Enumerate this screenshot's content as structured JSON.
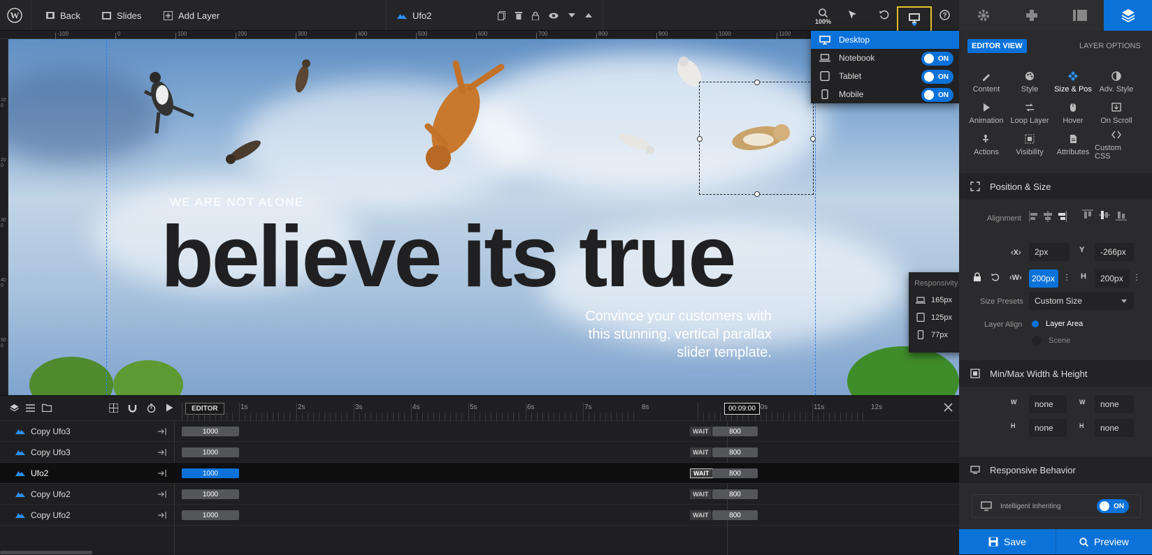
{
  "topbar": {
    "back_label": "Back",
    "slides_label": "Slides",
    "add_layer_label": "Add Layer",
    "layer_name": "Ufo2",
    "zoom": "100%"
  },
  "device_menu": {
    "items": [
      {
        "label": "Desktop",
        "toggle": ""
      },
      {
        "label": "Notebook",
        "toggle": "ON"
      },
      {
        "label": "Tablet",
        "toggle": "ON"
      },
      {
        "label": "Mobile",
        "toggle": "ON"
      }
    ]
  },
  "ruler": {
    "top_ticks": [
      "-100",
      "0",
      "100",
      "200",
      "300",
      "400",
      "500",
      "600",
      "700",
      "800",
      "900",
      "1000",
      "1100"
    ],
    "left_ticks": [
      "100",
      "200",
      "300",
      "400",
      "500"
    ]
  },
  "canvas": {
    "tagline": "WE ARE NOT ALONE",
    "headline": "believe its true",
    "body": "Convince your customers with this stunning, vertical parallax slider template."
  },
  "responsivity": {
    "title": "Responsivity",
    "items": [
      {
        "label": "165px"
      },
      {
        "label": "125px"
      },
      {
        "label": "77px"
      }
    ]
  },
  "right_panel": {
    "editor_view": "EDITOR VIEW",
    "layer_options": "LAYER OPTIONS",
    "tools": [
      {
        "label": "Content"
      },
      {
        "label": "Style"
      },
      {
        "label": "Size & Pos"
      },
      {
        "label": "Adv. Style"
      },
      {
        "label": "Animation"
      },
      {
        "label": "Loop Layer"
      },
      {
        "label": "Hover"
      },
      {
        "label": "On Scroll"
      },
      {
        "label": "Actions"
      },
      {
        "label": "Visibility"
      },
      {
        "label": "Attributes"
      },
      {
        "label": "Custom CSS"
      }
    ],
    "position_size": {
      "title": "Position & Size",
      "alignment_label": "Alignment",
      "x_label": "X",
      "x_value": "2px",
      "y_label": "Y",
      "y_value": "-266px",
      "w_label": "W",
      "w_value": "200px",
      "h_label": "H",
      "h_value": "200px",
      "size_presets_label": "Size Presets",
      "size_presets_value": "Custom Size",
      "layer_align_label": "Layer Align",
      "layer_area": "Layer Area",
      "scene": "Scene"
    },
    "minmax": {
      "title": "Min/Max Width & Height",
      "values": [
        "none",
        "none",
        "none",
        "none"
      ]
    },
    "responsive": {
      "title": "Responsive Behavior",
      "intelligent_inheriting": "Intelligent Inheriting",
      "toggle": "ON"
    },
    "save_label": "Save",
    "preview_label": "Preview"
  },
  "timeline": {
    "editor_label": "EDITOR",
    "current_time": "00:09:00",
    "seconds": [
      "1s",
      "2s",
      "3s",
      "4s",
      "5s",
      "6s",
      "7s",
      "8s",
      "10s",
      "11s",
      "12s"
    ],
    "rows": [
      {
        "name": "Copy Ufo3",
        "start": "1000",
        "wait": "WAIT",
        "end": "800"
      },
      {
        "name": "Copy Ufo3",
        "start": "1000",
        "wait": "WAIT",
        "end": "800"
      },
      {
        "name": "Ufo2",
        "start": "1000",
        "wait": "WAIT",
        "end": "800"
      },
      {
        "name": "Copy Ufo2",
        "start": "1000",
        "wait": "WAIT",
        "end": "800"
      },
      {
        "name": "Copy Ufo2",
        "start": "1000",
        "wait": "WAIT",
        "end": "800"
      }
    ]
  },
  "colors": {
    "accent": "#0b72d9",
    "highlight_border": "#e6c229"
  }
}
